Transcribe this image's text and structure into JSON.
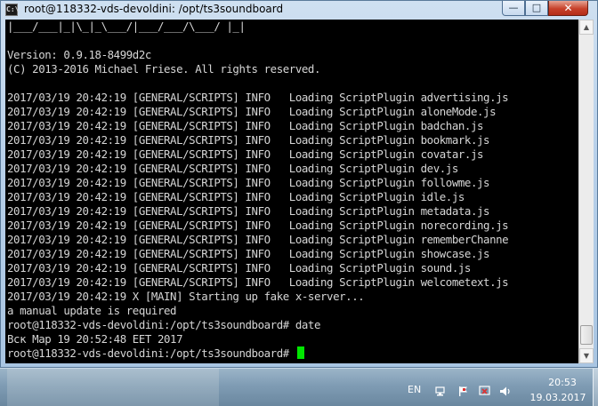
{
  "window": {
    "title": "root@118332-vds-devoldini: /opt/ts3soundboard",
    "icon_label": "C:\\",
    "controls": {
      "minimize": "—",
      "maximize": "□",
      "close": "✕"
    }
  },
  "terminal": {
    "lines": [
      "|___/___|_|\\_|_\\___/|___/___/\\___/ |_|",
      "",
      "Version: 0.9.18-8499d2c",
      "(C) 2013-2016 Michael Friese. All rights reserved.",
      "",
      "2017/03/19 20:42:19 [GENERAL/SCRIPTS] INFO   Loading ScriptPlugin advertising.js",
      "2017/03/19 20:42:19 [GENERAL/SCRIPTS] INFO   Loading ScriptPlugin aloneMode.js",
      "2017/03/19 20:42:19 [GENERAL/SCRIPTS] INFO   Loading ScriptPlugin badchan.js",
      "2017/03/19 20:42:19 [GENERAL/SCRIPTS] INFO   Loading ScriptPlugin bookmark.js",
      "2017/03/19 20:42:19 [GENERAL/SCRIPTS] INFO   Loading ScriptPlugin covatar.js",
      "2017/03/19 20:42:19 [GENERAL/SCRIPTS] INFO   Loading ScriptPlugin dev.js",
      "2017/03/19 20:42:19 [GENERAL/SCRIPTS] INFO   Loading ScriptPlugin followme.js",
      "2017/03/19 20:42:19 [GENERAL/SCRIPTS] INFO   Loading ScriptPlugin idle.js",
      "2017/03/19 20:42:19 [GENERAL/SCRIPTS] INFO   Loading ScriptPlugin metadata.js",
      "2017/03/19 20:42:19 [GENERAL/SCRIPTS] INFO   Loading ScriptPlugin norecording.js",
      "2017/03/19 20:42:19 [GENERAL/SCRIPTS] INFO   Loading ScriptPlugin rememberChanne",
      "2017/03/19 20:42:19 [GENERAL/SCRIPTS] INFO   Loading ScriptPlugin showcase.js",
      "2017/03/19 20:42:19 [GENERAL/SCRIPTS] INFO   Loading ScriptPlugin sound.js",
      "2017/03/19 20:42:19 [GENERAL/SCRIPTS] INFO   Loading ScriptPlugin welcometext.js",
      "2017/03/19 20:42:19 X [MAIN] Starting up fake x-server...",
      "a manual update is required",
      "root@118332-vds-devoldini:/opt/ts3soundboard# date",
      "Вск Мар 19 20:52:48 EET 2017"
    ],
    "prompt": "root@118332-vds-devoldini:/opt/ts3soundboard# ",
    "cursor_color": "#00e600",
    "text_color": "#d6d6d6",
    "background": "#000000"
  },
  "taskbar": {
    "language": "EN",
    "clock_time": "20:53",
    "clock_date": "19.03.2017",
    "tray_icons": [
      "network-icon",
      "flag-icon",
      "action-center-icon",
      "volume-icon"
    ]
  }
}
